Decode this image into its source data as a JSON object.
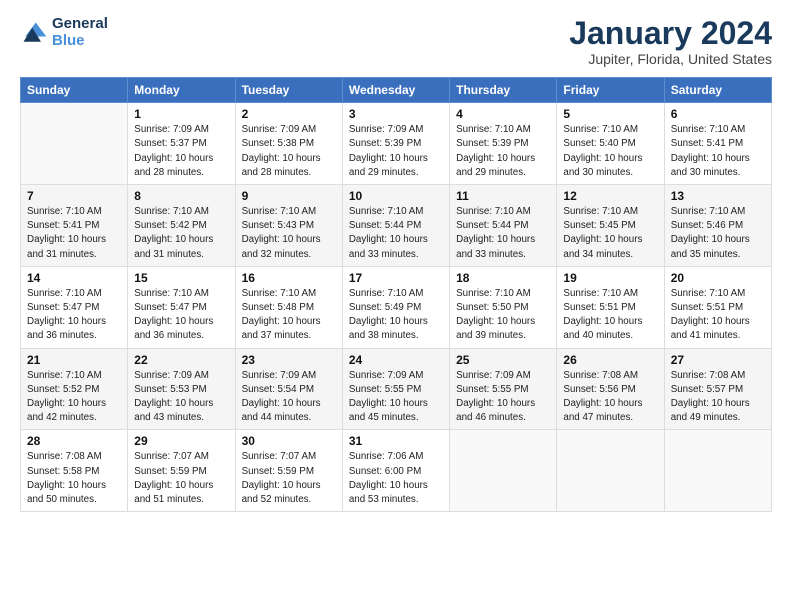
{
  "logo": {
    "text1": "General",
    "text2": "Blue"
  },
  "title": "January 2024",
  "subtitle": "Jupiter, Florida, United States",
  "headers": [
    "Sunday",
    "Monday",
    "Tuesday",
    "Wednesday",
    "Thursday",
    "Friday",
    "Saturday"
  ],
  "weeks": [
    [
      {
        "num": "",
        "lines": []
      },
      {
        "num": "1",
        "lines": [
          "Sunrise: 7:09 AM",
          "Sunset: 5:37 PM",
          "Daylight: 10 hours",
          "and 28 minutes."
        ]
      },
      {
        "num": "2",
        "lines": [
          "Sunrise: 7:09 AM",
          "Sunset: 5:38 PM",
          "Daylight: 10 hours",
          "and 28 minutes."
        ]
      },
      {
        "num": "3",
        "lines": [
          "Sunrise: 7:09 AM",
          "Sunset: 5:39 PM",
          "Daylight: 10 hours",
          "and 29 minutes."
        ]
      },
      {
        "num": "4",
        "lines": [
          "Sunrise: 7:10 AM",
          "Sunset: 5:39 PM",
          "Daylight: 10 hours",
          "and 29 minutes."
        ]
      },
      {
        "num": "5",
        "lines": [
          "Sunrise: 7:10 AM",
          "Sunset: 5:40 PM",
          "Daylight: 10 hours",
          "and 30 minutes."
        ]
      },
      {
        "num": "6",
        "lines": [
          "Sunrise: 7:10 AM",
          "Sunset: 5:41 PM",
          "Daylight: 10 hours",
          "and 30 minutes."
        ]
      }
    ],
    [
      {
        "num": "7",
        "lines": [
          "Sunrise: 7:10 AM",
          "Sunset: 5:41 PM",
          "Daylight: 10 hours",
          "and 31 minutes."
        ]
      },
      {
        "num": "8",
        "lines": [
          "Sunrise: 7:10 AM",
          "Sunset: 5:42 PM",
          "Daylight: 10 hours",
          "and 31 minutes."
        ]
      },
      {
        "num": "9",
        "lines": [
          "Sunrise: 7:10 AM",
          "Sunset: 5:43 PM",
          "Daylight: 10 hours",
          "and 32 minutes."
        ]
      },
      {
        "num": "10",
        "lines": [
          "Sunrise: 7:10 AM",
          "Sunset: 5:44 PM",
          "Daylight: 10 hours",
          "and 33 minutes."
        ]
      },
      {
        "num": "11",
        "lines": [
          "Sunrise: 7:10 AM",
          "Sunset: 5:44 PM",
          "Daylight: 10 hours",
          "and 33 minutes."
        ]
      },
      {
        "num": "12",
        "lines": [
          "Sunrise: 7:10 AM",
          "Sunset: 5:45 PM",
          "Daylight: 10 hours",
          "and 34 minutes."
        ]
      },
      {
        "num": "13",
        "lines": [
          "Sunrise: 7:10 AM",
          "Sunset: 5:46 PM",
          "Daylight: 10 hours",
          "and 35 minutes."
        ]
      }
    ],
    [
      {
        "num": "14",
        "lines": [
          "Sunrise: 7:10 AM",
          "Sunset: 5:47 PM",
          "Daylight: 10 hours",
          "and 36 minutes."
        ]
      },
      {
        "num": "15",
        "lines": [
          "Sunrise: 7:10 AM",
          "Sunset: 5:47 PM",
          "Daylight: 10 hours",
          "and 36 minutes."
        ]
      },
      {
        "num": "16",
        "lines": [
          "Sunrise: 7:10 AM",
          "Sunset: 5:48 PM",
          "Daylight: 10 hours",
          "and 37 minutes."
        ]
      },
      {
        "num": "17",
        "lines": [
          "Sunrise: 7:10 AM",
          "Sunset: 5:49 PM",
          "Daylight: 10 hours",
          "and 38 minutes."
        ]
      },
      {
        "num": "18",
        "lines": [
          "Sunrise: 7:10 AM",
          "Sunset: 5:50 PM",
          "Daylight: 10 hours",
          "and 39 minutes."
        ]
      },
      {
        "num": "19",
        "lines": [
          "Sunrise: 7:10 AM",
          "Sunset: 5:51 PM",
          "Daylight: 10 hours",
          "and 40 minutes."
        ]
      },
      {
        "num": "20",
        "lines": [
          "Sunrise: 7:10 AM",
          "Sunset: 5:51 PM",
          "Daylight: 10 hours",
          "and 41 minutes."
        ]
      }
    ],
    [
      {
        "num": "21",
        "lines": [
          "Sunrise: 7:10 AM",
          "Sunset: 5:52 PM",
          "Daylight: 10 hours",
          "and 42 minutes."
        ]
      },
      {
        "num": "22",
        "lines": [
          "Sunrise: 7:09 AM",
          "Sunset: 5:53 PM",
          "Daylight: 10 hours",
          "and 43 minutes."
        ]
      },
      {
        "num": "23",
        "lines": [
          "Sunrise: 7:09 AM",
          "Sunset: 5:54 PM",
          "Daylight: 10 hours",
          "and 44 minutes."
        ]
      },
      {
        "num": "24",
        "lines": [
          "Sunrise: 7:09 AM",
          "Sunset: 5:55 PM",
          "Daylight: 10 hours",
          "and 45 minutes."
        ]
      },
      {
        "num": "25",
        "lines": [
          "Sunrise: 7:09 AM",
          "Sunset: 5:55 PM",
          "Daylight: 10 hours",
          "and 46 minutes."
        ]
      },
      {
        "num": "26",
        "lines": [
          "Sunrise: 7:08 AM",
          "Sunset: 5:56 PM",
          "Daylight: 10 hours",
          "and 47 minutes."
        ]
      },
      {
        "num": "27",
        "lines": [
          "Sunrise: 7:08 AM",
          "Sunset: 5:57 PM",
          "Daylight: 10 hours",
          "and 49 minutes."
        ]
      }
    ],
    [
      {
        "num": "28",
        "lines": [
          "Sunrise: 7:08 AM",
          "Sunset: 5:58 PM",
          "Daylight: 10 hours",
          "and 50 minutes."
        ]
      },
      {
        "num": "29",
        "lines": [
          "Sunrise: 7:07 AM",
          "Sunset: 5:59 PM",
          "Daylight: 10 hours",
          "and 51 minutes."
        ]
      },
      {
        "num": "30",
        "lines": [
          "Sunrise: 7:07 AM",
          "Sunset: 5:59 PM",
          "Daylight: 10 hours",
          "and 52 minutes."
        ]
      },
      {
        "num": "31",
        "lines": [
          "Sunrise: 7:06 AM",
          "Sunset: 6:00 PM",
          "Daylight: 10 hours",
          "and 53 minutes."
        ]
      },
      {
        "num": "",
        "lines": []
      },
      {
        "num": "",
        "lines": []
      },
      {
        "num": "",
        "lines": []
      }
    ]
  ]
}
